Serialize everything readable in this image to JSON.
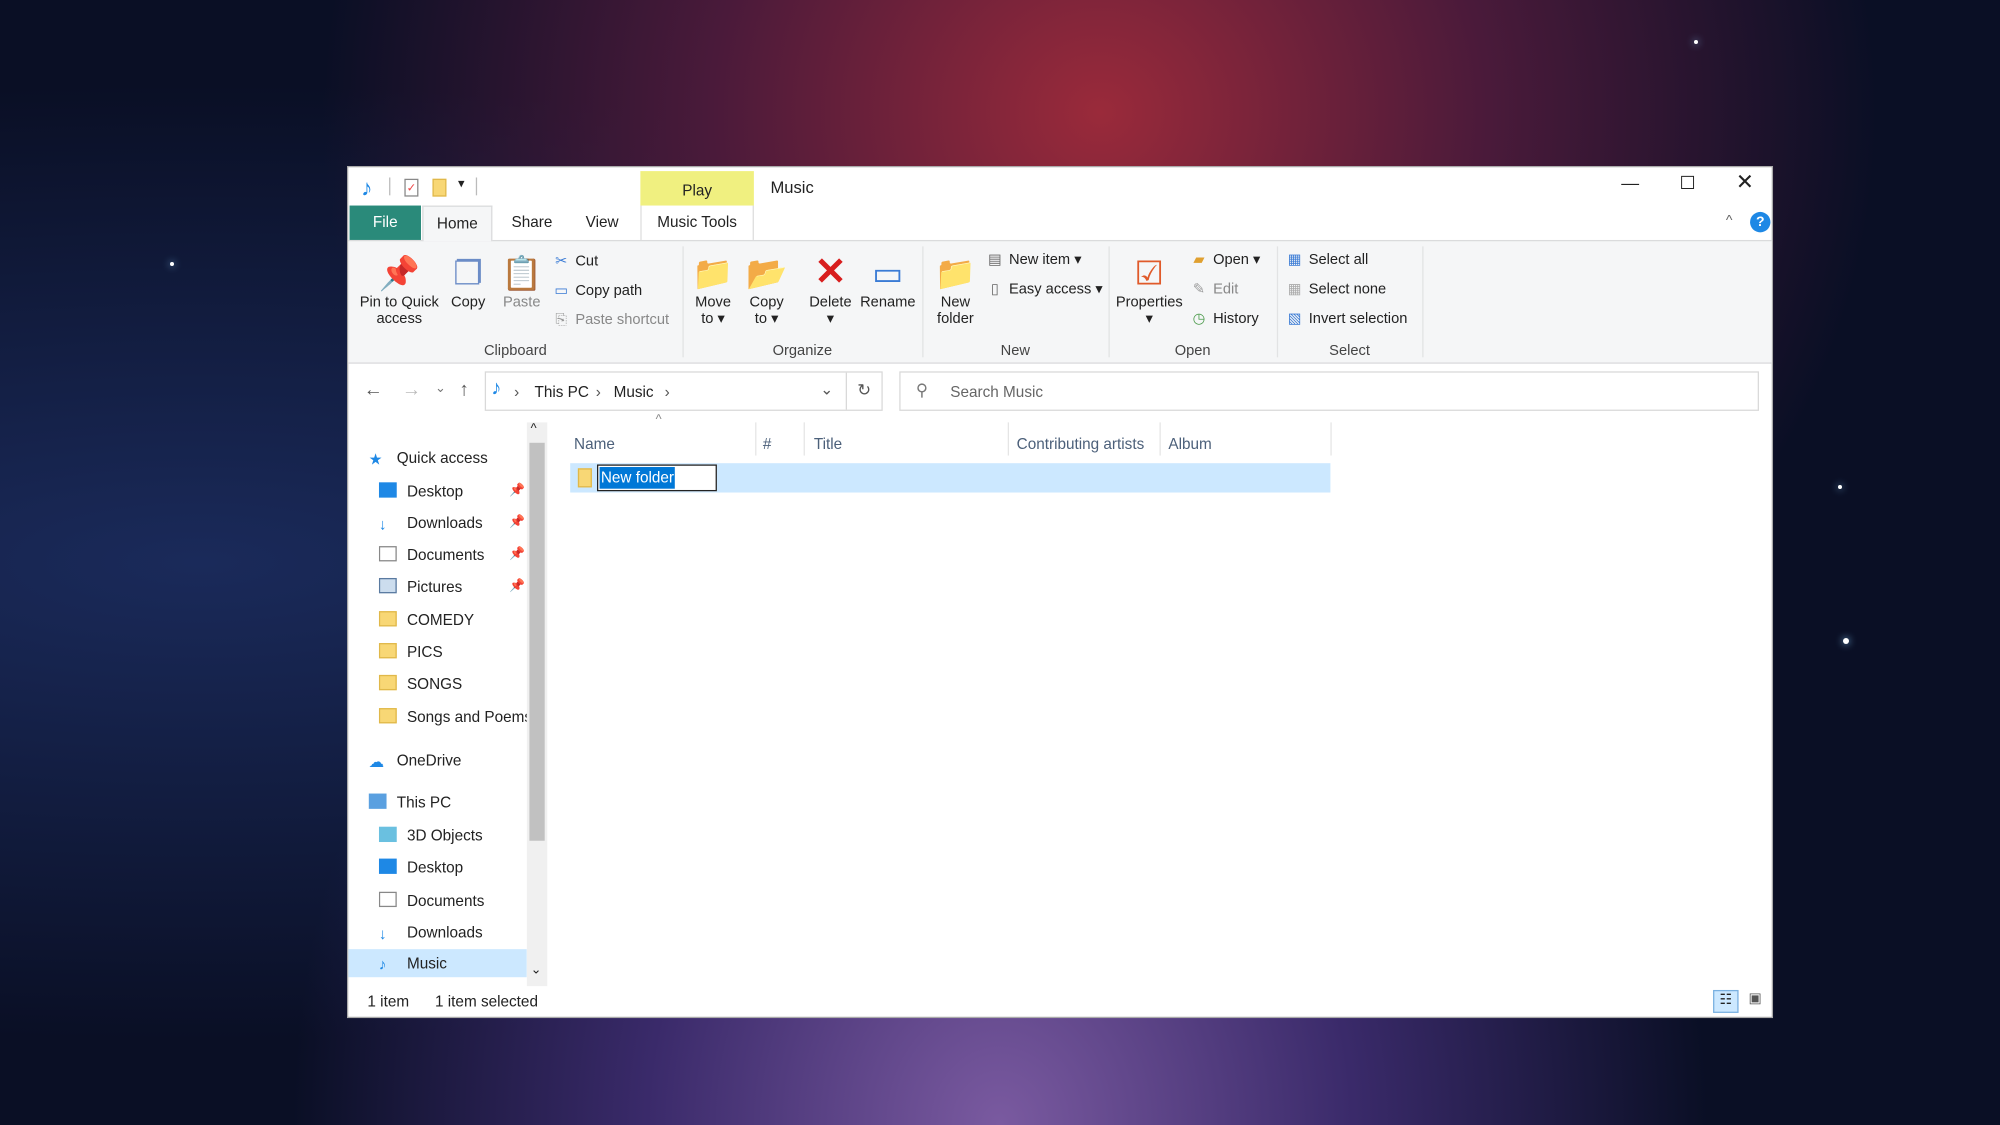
{
  "window": {
    "title": "Music",
    "context_tab": "Play"
  },
  "quick_access_toolbar": [
    "music-icon",
    "properties-icon",
    "new-folder-icon",
    "customize-dropdown"
  ],
  "window_controls": [
    "minimize",
    "maximize",
    "close"
  ],
  "tabs": [
    {
      "label": "File"
    },
    {
      "label": "Home",
      "active": true
    },
    {
      "label": "Share"
    },
    {
      "label": "View"
    },
    {
      "label": "Music Tools"
    }
  ],
  "ribbon": {
    "clipboard": {
      "label": "Clipboard",
      "pin": "Pin to Quick access",
      "pin_l1": "Pin to Quick",
      "pin_l2": "access",
      "copy": "Copy",
      "paste": "Paste",
      "cut": "Cut",
      "copy_path": "Copy path",
      "paste_shortcut": "Paste shortcut"
    },
    "organize": {
      "label": "Organize",
      "move_l1": "Move",
      "move_l2": "to",
      "copy_l1": "Copy",
      "copy_l2": "to",
      "delete": "Delete",
      "rename": "Rename"
    },
    "new": {
      "label": "New",
      "new_folder_l1": "New",
      "new_folder_l2": "folder",
      "new_item": "New item",
      "easy_access": "Easy access"
    },
    "open": {
      "label": "Open",
      "properties": "Properties",
      "open": "Open",
      "edit": "Edit",
      "history": "History"
    },
    "select": {
      "label": "Select",
      "select_all": "Select all",
      "select_none": "Select none",
      "invert": "Invert selection"
    }
  },
  "address": {
    "crumbs": [
      "This PC",
      "Music"
    ]
  },
  "search": {
    "placeholder": "Search Music"
  },
  "columns": [
    "Name",
    "#",
    "Title",
    "Contributing artists",
    "Album"
  ],
  "files": [
    {
      "name": "New folder",
      "editing": true
    }
  ],
  "nav": {
    "quick_access": "Quick access",
    "pinned": [
      "Desktop",
      "Downloads",
      "Documents",
      "Pictures"
    ],
    "folders": [
      "COMEDY",
      "PICS",
      "SONGS",
      "Songs and Poems"
    ],
    "onedrive": "OneDrive",
    "this_pc": "This PC",
    "pc_items": [
      "3D Objects",
      "Desktop",
      "Documents",
      "Downloads",
      "Music"
    ],
    "selected": "Music"
  },
  "status": {
    "count": "1 item",
    "selection": "1 item selected"
  },
  "colors": {
    "file_tab": "#2a8a7a",
    "play_tab": "#f0f080",
    "selection": "#cce8ff",
    "accent": "#0078d7"
  }
}
